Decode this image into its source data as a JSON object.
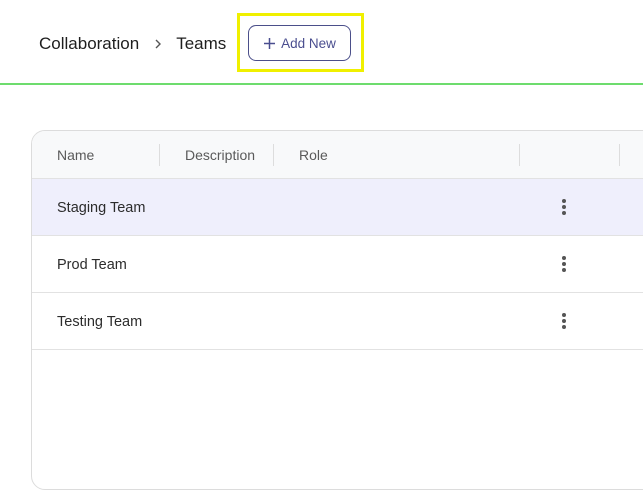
{
  "breadcrumb": {
    "items": [
      "Collaboration",
      "Teams"
    ]
  },
  "toolbar": {
    "add_new_label": "Add New"
  },
  "table": {
    "columns": [
      "Name",
      "Description",
      "Role"
    ],
    "rows": [
      {
        "name": "Staging Team",
        "description": "",
        "role": ""
      },
      {
        "name": "Prod Team",
        "description": "",
        "role": ""
      },
      {
        "name": "Testing Team",
        "description": "",
        "role": ""
      }
    ]
  },
  "colors": {
    "accent": "#4a4e8f",
    "highlight": "#f0f000",
    "header_underline": "#6ddc6d",
    "selected_row": "#efeffc"
  }
}
